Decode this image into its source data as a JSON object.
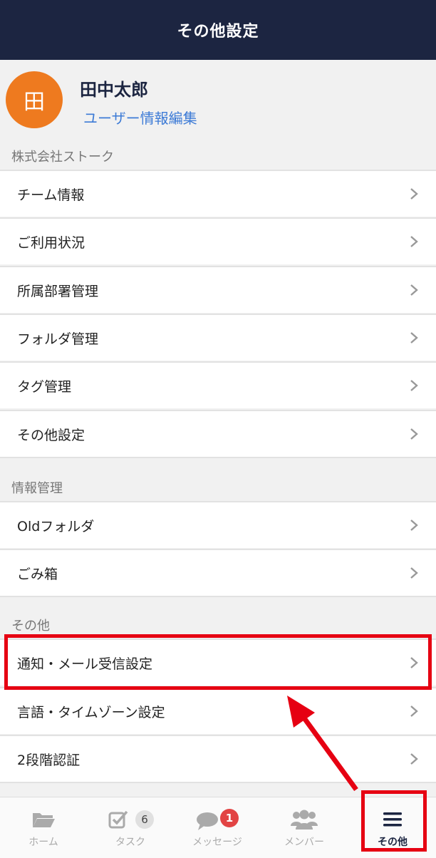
{
  "header": {
    "title": "その他設定"
  },
  "profile": {
    "avatar_glyph": "田",
    "name": "田中太郎",
    "edit_link": "ユーザー情報編集"
  },
  "sections": [
    {
      "label": "株式会社ストーク",
      "items": [
        "チーム情報",
        "ご利用状況",
        "所属部署管理",
        "フォルダ管理",
        "タグ管理",
        "その他設定"
      ]
    },
    {
      "label": "情報管理",
      "items": [
        "Oldフォルダ",
        "ごみ箱"
      ]
    },
    {
      "label": "その他",
      "items": [
        "通知・メール受信設定",
        "言語・タイムゾーン設定",
        "2段階認証"
      ]
    }
  ],
  "tabbar": {
    "tabs": [
      {
        "label": "ホーム",
        "icon": "folder-icon"
      },
      {
        "label": "タスク",
        "icon": "checkbox-icon",
        "badge": "6"
      },
      {
        "label": "メッセージ",
        "icon": "chat-icon",
        "badge": "1"
      },
      {
        "label": "メンバー",
        "icon": "members-icon"
      },
      {
        "label": "その他",
        "icon": "menu-icon",
        "active": true
      }
    ]
  },
  "colors": {
    "header": "#1c2541",
    "avatar": "#ee7a1f",
    "link": "#3d7bd6",
    "highlight": "#e60012",
    "badge": "#e24444"
  }
}
